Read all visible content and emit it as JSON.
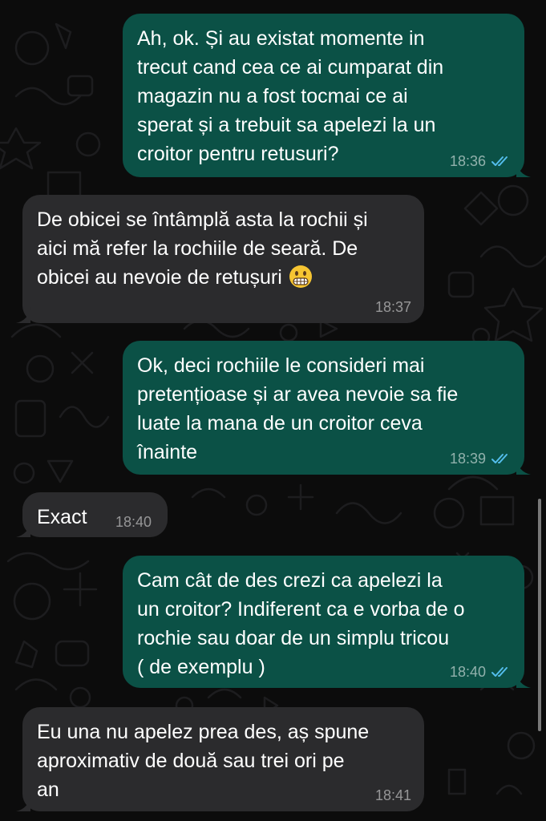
{
  "messages": [
    {
      "direction": "outgoing",
      "text": "Ah, ok. Și au existat momente in\ntrecut cand cea ce ai cumparat din\nmagazin nu a fost tocmai ce ai\nsperat și a trebuit sa apelezi la un\ncroitor pentru retusuri?",
      "time": "18:36",
      "status": "read"
    },
    {
      "direction": "incoming",
      "text": "De obicei se întâmplă asta la rochii și\naici mă refer la rochiile de seară. De\nobicei au nevoie de retușuri",
      "emoji": "grimacing-face",
      "time": "18:37"
    },
    {
      "direction": "outgoing",
      "text": "Ok, deci rochiile le consideri mai\npretențioase și ar avea nevoie sa fie\nluate la mana de un croitor ceva\nînainte",
      "time": "18:39",
      "status": "read"
    },
    {
      "direction": "incoming",
      "text": "Exact",
      "time": "18:40"
    },
    {
      "direction": "outgoing",
      "text": "Cam cât de des crezi ca apelezi la\nun croitor? Indiferent ca e vorba de o\nrochie sau doar de un simplu tricou\n( de exemplu )",
      "time": "18:40",
      "status": "read"
    },
    {
      "direction": "incoming",
      "text": "Eu una nu apelez prea des, aș spune\naproximativ de două sau trei ori pe\nan",
      "time": "18:41"
    }
  ],
  "colors": {
    "background": "#0c0c0c",
    "outgoing_bubble": "#0b5146",
    "incoming_bubble": "#2b2b2d",
    "read_ticks": "#53bdeb"
  }
}
